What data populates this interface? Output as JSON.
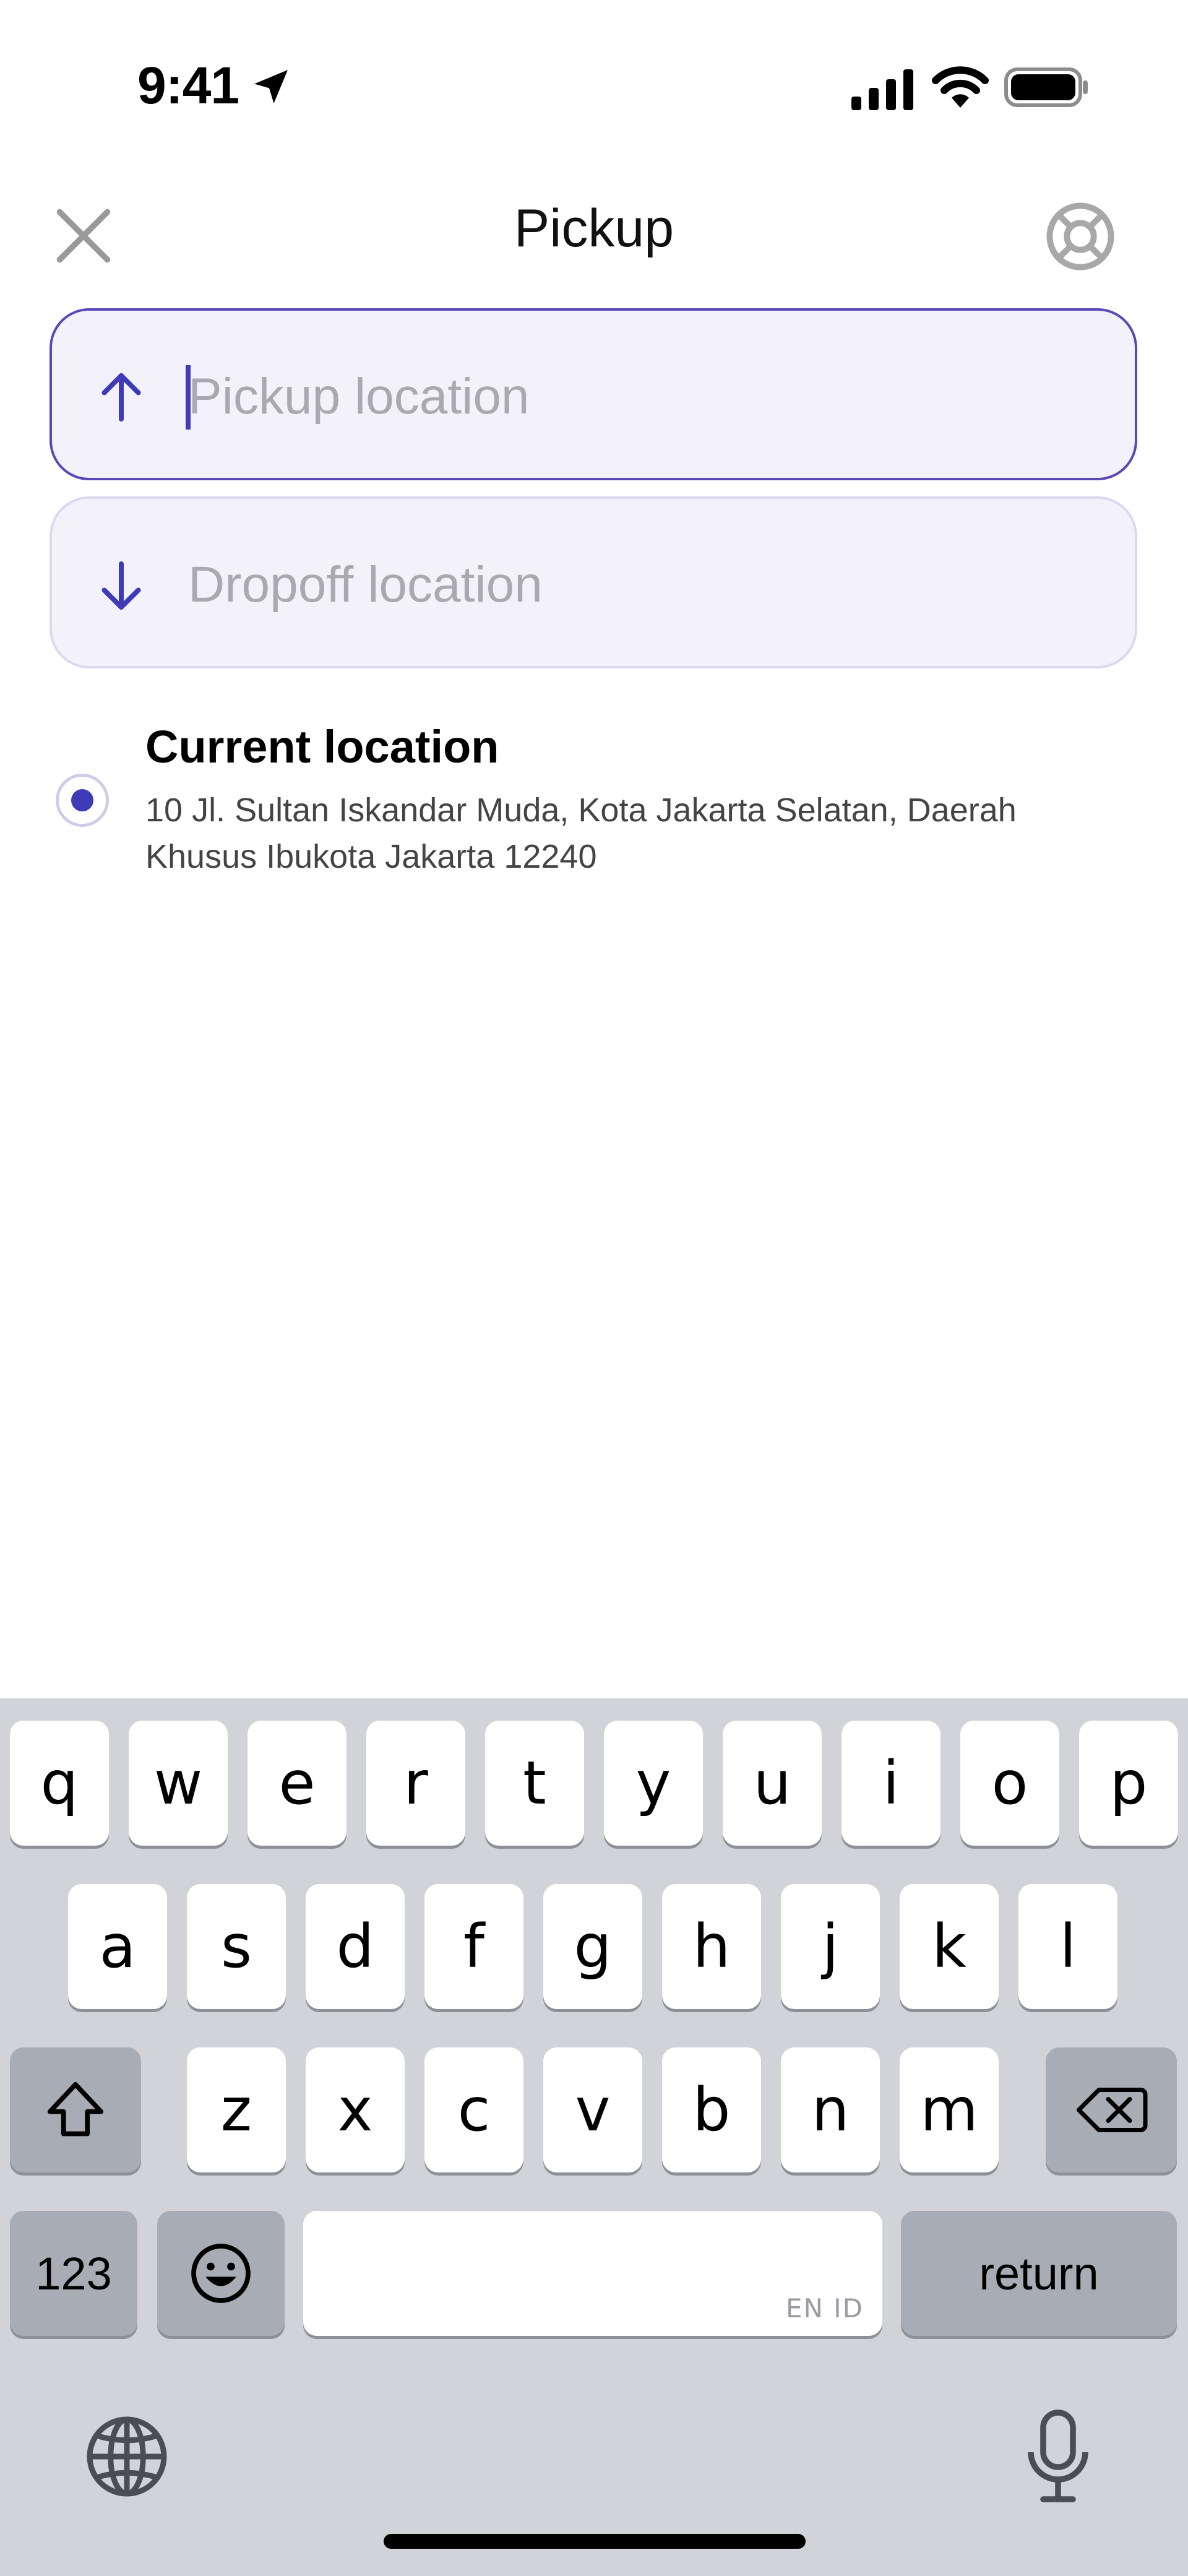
{
  "status_bar": {
    "time": "9:41",
    "icons": [
      "location-arrow-icon",
      "cellular-signal-icon",
      "wifi-icon",
      "battery-icon"
    ]
  },
  "header": {
    "title": "Pickup",
    "close_icon": "close-icon",
    "help_icon": "lifebuoy-icon"
  },
  "pickup_field": {
    "placeholder": "Pickup location",
    "icon": "arrow-up-icon"
  },
  "dropoff_field": {
    "placeholder": "Dropoff location",
    "icon": "arrow-down-icon"
  },
  "current_location": {
    "title": "Current location",
    "address": "10 Jl. Sultan Iskandar Muda, Kota Jakarta Selatan, Daerah Khusus Ibukota Jakarta 12240",
    "selected": true
  },
  "keyboard": {
    "row1": [
      "q",
      "w",
      "e",
      "r",
      "t",
      "y",
      "u",
      "i",
      "o",
      "p"
    ],
    "row2": [
      "a",
      "s",
      "d",
      "f",
      "g",
      "h",
      "j",
      "k",
      "l"
    ],
    "row3": [
      "z",
      "x",
      "c",
      "v",
      "b",
      "n",
      "m"
    ],
    "numbers_label": "123",
    "space_hint": "EN ID",
    "return_label": "return",
    "icons": [
      "shift-icon",
      "backspace-icon",
      "emoji-icon",
      "globe-icon",
      "microphone-icon"
    ]
  },
  "colors": {
    "accent": "#3f3ab8",
    "field_bg": "#f3f2fb",
    "field_border_active": "#5b47b6",
    "keyboard_bg": "#d1d3d9"
  }
}
